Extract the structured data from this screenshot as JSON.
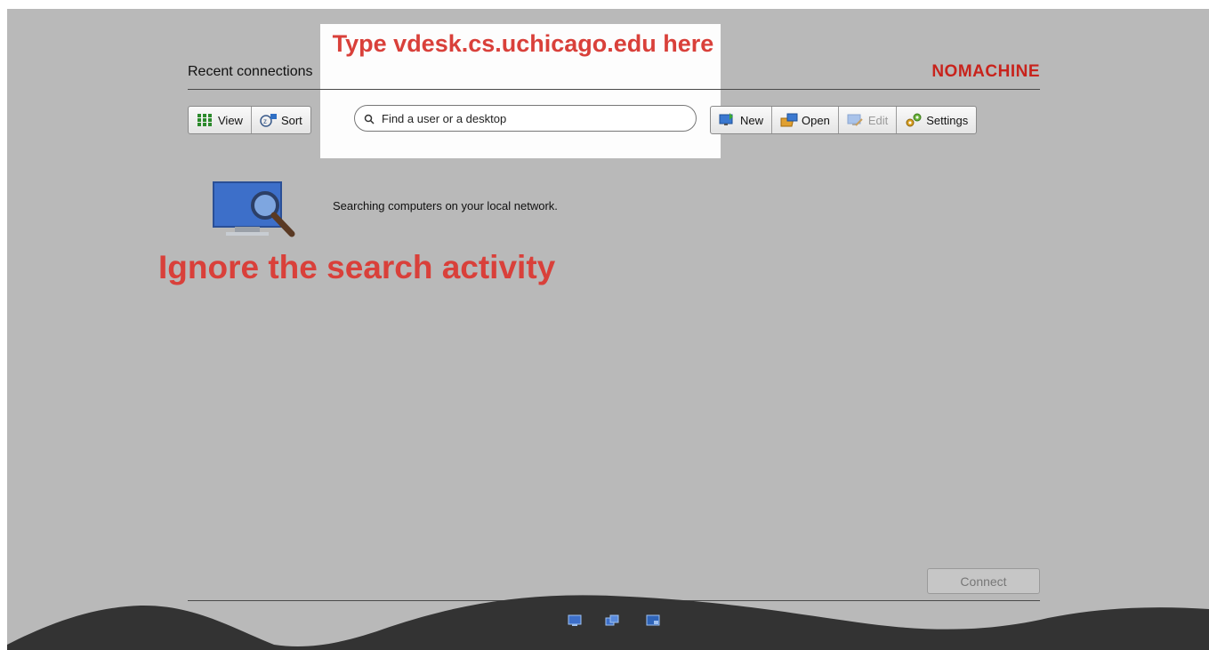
{
  "header": {
    "title": "Recent connections",
    "logo": "NOMACHINE"
  },
  "toolbar_left": [
    {
      "label": "View",
      "icon": "grid-view-icon"
    },
    {
      "label": "Sort",
      "icon": "sort-icon"
    }
  ],
  "search": {
    "placeholder": "Find a user or a desktop",
    "icon": "search-icon"
  },
  "toolbar_right": [
    {
      "label": "New",
      "icon": "new-monitor-icon",
      "enabled": true
    },
    {
      "label": "Open",
      "icon": "open-folder-icon",
      "enabled": true
    },
    {
      "label": "Edit",
      "icon": "edit-monitor-icon",
      "enabled": false
    },
    {
      "label": "Settings",
      "icon": "gears-icon",
      "enabled": true
    }
  ],
  "status": {
    "text": "Searching computers on your local network.",
    "icon": "monitor-search-icon"
  },
  "annotations": {
    "top": "Type vdesk.cs.uchicago.edu here",
    "middle": "Ignore the search activity",
    "color": "#d9403a"
  },
  "connect": {
    "label": "Connect",
    "enabled": false
  },
  "tray_icons": [
    "tray-monitor-icon",
    "tray-network-icon",
    "tray-window-icon"
  ],
  "colors": {
    "background": "#b9b9b9",
    "logo": "#c8231c",
    "highlight": "#fdfdfd"
  }
}
